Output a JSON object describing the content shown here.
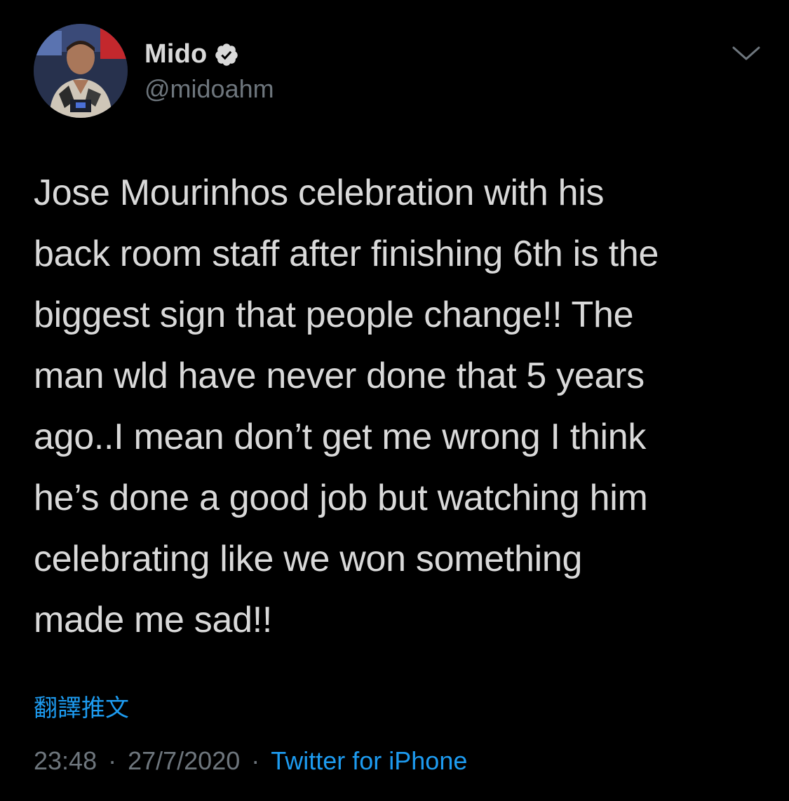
{
  "colors": {
    "background": "#000000",
    "text": "#d9d9d9",
    "muted": "#6e767d",
    "link": "#1d9bf0"
  },
  "tweet": {
    "author": {
      "display_name": "Mido",
      "handle": "@midoahm",
      "verified": true,
      "avatar_icon": "user-avatar"
    },
    "menu_icon": "chevron-down-icon",
    "text": "Jose Mourinhos celebration with his\nback room staff after finishing 6th is the\nbiggest sign that people change!! The\nman wld have never done that 5 years\nago..I mean don’t get me wrong I think\nhe’s done a good job but watching him\ncelebrating like we won something\nmade me sad!!",
    "translate_label": "翻譯推文",
    "time": "23:48",
    "date": "27/7/2020",
    "separator": "·",
    "source": "Twitter for iPhone"
  }
}
